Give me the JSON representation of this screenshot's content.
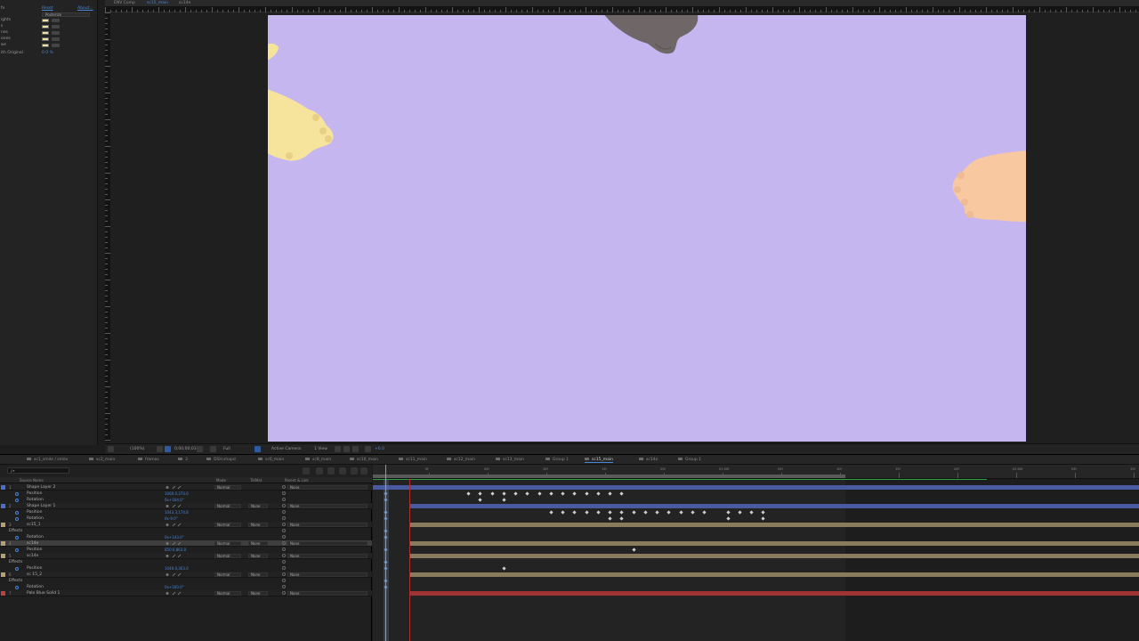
{
  "effect_controls": {
    "rows": [
      {
        "label": "fx",
        "value": "Reset",
        "extra": "About..."
      },
      {
        "label": "",
        "dropdown": "Posterize"
      },
      {
        "label": "ights",
        "swatch": "#f2e0a0"
      },
      {
        "label": "s",
        "swatch": "#f2e0a0"
      },
      {
        "label": "nes",
        "swatch": "#f2e0a0"
      },
      {
        "label": "ones",
        "swatch": "#f2e0a0"
      },
      {
        "label": "ws",
        "swatch": "#f2e0a0"
      },
      {
        "label": "ith Original",
        "value": "0.0 %"
      }
    ]
  },
  "viewer": {
    "tabs": [
      "ENV Comp",
      "sc15_main",
      "sc14e"
    ],
    "active_tab": "sc15_main",
    "canvas_color": "#c6b6f0",
    "footer": {
      "zoom": "(100%)",
      "timecode": "0;00;00;03",
      "resolution": "Full",
      "camera": "Active Camera",
      "view": "1 View",
      "exposure": "+0.0"
    }
  },
  "timeline": {
    "tabs": [
      {
        "label": "sc1_smile / smile",
        "color": "#6a6a6a"
      },
      {
        "label": "sc2_main",
        "color": "#6a6a6a"
      },
      {
        "label": "frames",
        "color": "#6a6a6a"
      },
      {
        "label": "3",
        "color": "#6a6a6a"
      },
      {
        "label": "DSH.shapd",
        "color": "#6a6a6a"
      },
      {
        "label": "sc6_main",
        "color": "#6a6a6a"
      },
      {
        "label": "sc8_main",
        "color": "#6a6a6a"
      },
      {
        "label": "sc10_main",
        "color": "#6a6a6a"
      },
      {
        "label": "sc11_main",
        "color": "#6a6a6a"
      },
      {
        "label": "sc12_main",
        "color": "#6a6a6a"
      },
      {
        "label": "sc13_main",
        "color": "#6a6a6a"
      },
      {
        "label": "Group 1",
        "color": "#6a6a6a"
      },
      {
        "label": "sc15_main",
        "color": "#6a6a6a",
        "active": true
      },
      {
        "label": "sc14e",
        "color": "#6a6a6a"
      },
      {
        "label": "Group 1",
        "color": "#6a6a6a"
      }
    ],
    "search_placeholder": "ρ▾",
    "headers": {
      "source_name": "Source Name",
      "mode": "Mode",
      "trkmat": "TrkMat",
      "parent": "Parent & Link"
    },
    "ruler_labels": [
      "0f",
      "05f",
      "10f",
      "15f",
      "20f",
      "01:00f",
      "05f",
      "10f",
      "15f",
      "20f",
      "02:00f",
      "05f",
      "10f"
    ],
    "layers": [
      {
        "kind": "layer",
        "num": "1",
        "name": "Shape Layer 2",
        "color": "#4a6fd0",
        "mode": "Normal",
        "trk": "",
        "parent": "None"
      },
      {
        "kind": "prop",
        "name": "Position",
        "value": "1060.0,373.0"
      },
      {
        "kind": "prop",
        "name": "Rotation",
        "value": "0x+164.0°"
      },
      {
        "kind": "layer",
        "num": "2",
        "name": "Shape Layer 1",
        "color": "#4a6fd0",
        "mode": "Normal",
        "trk": "None",
        "parent": "None"
      },
      {
        "kind": "prop",
        "name": "Position",
        "value": "1043.3,174.8"
      },
      {
        "kind": "prop",
        "name": "Rotation",
        "value": "0x-9.0°"
      },
      {
        "kind": "layer",
        "num": "3",
        "name": "sc15_1",
        "color": "#b8a070",
        "mode": "Normal",
        "trk": "None",
        "parent": "None"
      },
      {
        "kind": "prop",
        "name": "Effects",
        "value": ""
      },
      {
        "kind": "prop",
        "name": "Rotation",
        "value": "0x+143.0°"
      },
      {
        "kind": "layer",
        "num": "4",
        "name": "sc14e",
        "color": "#b8a070",
        "mode": "Normal",
        "trk": "None",
        "parent": "None",
        "selected": true
      },
      {
        "kind": "prop",
        "name": "Position",
        "value": "850.0,863.0"
      },
      {
        "kind": "layer",
        "num": "5",
        "name": "sc14e",
        "color": "#b8a070",
        "mode": "Normal",
        "trk": "None",
        "parent": "None"
      },
      {
        "kind": "prop",
        "name": "Effects",
        "value": ""
      },
      {
        "kind": "prop",
        "name": "Position",
        "value": "1049.0,303.0"
      },
      {
        "kind": "layer",
        "num": "6",
        "name": "sc 15_2",
        "color": "#b8a070",
        "mode": "Normal",
        "trk": "None",
        "parent": "None"
      },
      {
        "kind": "prop",
        "name": "Effects",
        "value": ""
      },
      {
        "kind": "prop",
        "name": "Rotation",
        "value": "0x+160.0°"
      },
      {
        "kind": "layer",
        "num": "7",
        "name": "Pale Blue Solid 1",
        "color": "#c04040",
        "mode": "Normal",
        "trk": "None",
        "parent": "None"
      }
    ],
    "track_colors": {
      "blue": "#4a5aa0",
      "tan": "#8a7a5e",
      "red": "#a03434"
    }
  }
}
